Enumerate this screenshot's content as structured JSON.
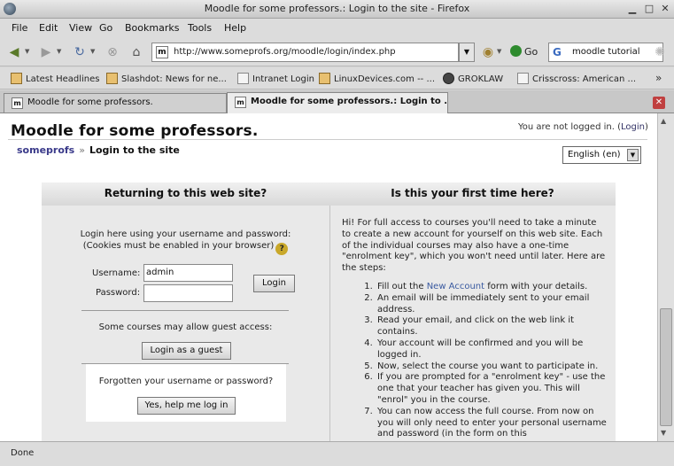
{
  "window": {
    "title": "Moodle for some professors.: Login to the site - Firefox"
  },
  "menu": [
    "File",
    "Edit",
    "View",
    "Go",
    "Bookmarks",
    "Tools",
    "Help"
  ],
  "nav": {
    "url": "http://www.someprofs.org/moodle/login/index.php",
    "go_label": "Go",
    "search_query": "moodle tutorial"
  },
  "bookmarks": [
    {
      "label": "Latest Headlines",
      "icon": "rss-icon"
    },
    {
      "label": "Slashdot: News for ne...",
      "icon": "rss-icon"
    },
    {
      "label": "Intranet Login",
      "icon": "page-icon"
    },
    {
      "label": "LinuxDevices.com -- ...",
      "icon": "rss-icon"
    },
    {
      "label": "GROKLAW",
      "icon": "gnu-icon"
    },
    {
      "label": "Crisscross: American ...",
      "icon": "page-icon"
    }
  ],
  "tabs": [
    {
      "label": "Moodle for some professors.",
      "active": false
    },
    {
      "label": "Moodle for some professors.: Login to ...",
      "active": true
    }
  ],
  "page": {
    "site_title": "Moodle for some professors.",
    "login_info_prefix": "You are not logged in. (",
    "login_info_link": "Login",
    "login_info_suffix": ")",
    "breadcrumb_home": "someprofs",
    "breadcrumb_sep": "»",
    "breadcrumb_current": "Login to the site",
    "language": "English (en)"
  },
  "login_panel": {
    "heading": "Returning to this web site?",
    "intro_line1": "Login here using your username and password:",
    "intro_line2": "(Cookies must be enabled in your browser)",
    "username_label": "Username:",
    "username_value": "admin",
    "password_label": "Password:",
    "password_value": "",
    "login_button": "Login",
    "guest_text": "Some courses may allow guest access:",
    "guest_button": "Login as a guest",
    "forgot_text": "Forgotten your username or password?",
    "forgot_button": "Yes, help me log in"
  },
  "signup_panel": {
    "heading": "Is this your first time here?",
    "intro": "Hi! For full access to courses you'll need to take a minute to create a new account for yourself on this web site. Each of the individual courses may also have a one-time \"enrolment key\", which you won't need until later. Here are the steps:",
    "step1_before": "Fill out the ",
    "step1_link": "New Account",
    "step1_after": " form with your details.",
    "steps": [
      "An email will be immediately sent to your email address.",
      "Read your email, and click on the web link it contains.",
      "Your account will be confirmed and you will be logged in.",
      "Now, select the course you want to participate in.",
      "If you are prompted for a \"enrolment key\" - use the one that your teacher has given you. This will \"enrol\" you in the course.",
      "You can now access the full course. From now on you will only need to enter your personal username and password (in the form on this"
    ]
  },
  "status": {
    "text": "Done"
  }
}
